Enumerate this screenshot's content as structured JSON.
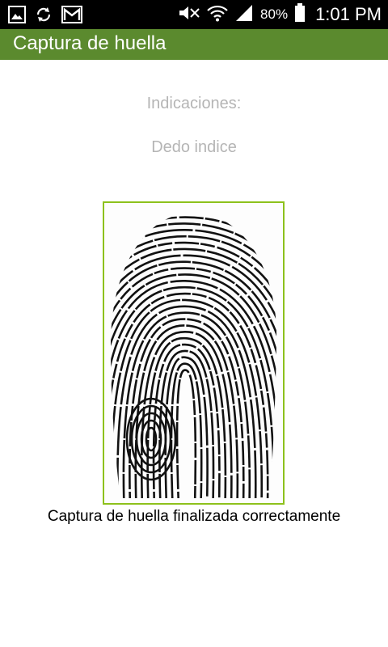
{
  "status_bar": {
    "left_icons": [
      "gallery-icon",
      "sync-icon",
      "gmail-icon"
    ],
    "right_icons": [
      "mute-icon",
      "wifi-icon",
      "signal-icon",
      "battery-icon"
    ],
    "battery_percent": "80%",
    "time": "1:01 PM"
  },
  "app_bar": {
    "title": "Captura de huella",
    "color": "#5b8a2e"
  },
  "main": {
    "instructions_label": "Indicaciones:",
    "finger_label": "Dedo indice",
    "fingerprint_border_color": "#8dc11c",
    "result_message": "Captura de huella finalizada correctamente"
  }
}
